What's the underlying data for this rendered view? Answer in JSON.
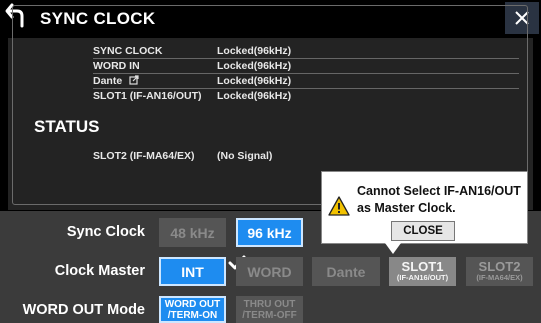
{
  "window": {
    "title": "SYNC CLOCK",
    "back_icon": "back-arrow-icon",
    "close_icon": "close-icon"
  },
  "status": {
    "label": "STATUS",
    "rows": [
      {
        "name": "SYNC CLOCK",
        "value": "Locked(96kHz)",
        "separator": true
      },
      {
        "name": "WORD IN",
        "value": "Locked(96kHz)",
        "separator": true
      },
      {
        "name": "Dante",
        "value": "Locked(96kHz)",
        "separator": true,
        "icon": "external-link-icon"
      },
      {
        "name": "SLOT1 (IF-AN16/OUT)",
        "value": "Locked(96kHz)",
        "separator": false
      },
      {
        "name": "SLOT2 (IF-MA64/EX)",
        "value": "(No Signal)",
        "separator": false
      }
    ]
  },
  "controls": {
    "sync_clock": {
      "label": "Sync Clock",
      "options": [
        "48 kHz",
        "96 kHz"
      ],
      "selected": "96 kHz"
    },
    "clock_master": {
      "label": "Clock Master",
      "int": "INT",
      "word": "WORD",
      "dante": "Dante",
      "slot1_line1": "SLOT1",
      "slot1_line2": "(IF-AN16/OUT)",
      "slot2_line1": "SLOT2",
      "slot2_line2": "(IF-MA64/EX)",
      "selected": "INT",
      "checked_icon": "checkmark-icon"
    },
    "word_out_mode": {
      "label": "WORD OUT Mode",
      "opt1_line1": "WORD OUT",
      "opt1_line2": "/TERM-ON",
      "opt2_line1": "THRU OUT",
      "opt2_line2": "/TERM-OFF",
      "selected": "WORD OUT /TERM-ON"
    }
  },
  "popup": {
    "message_line1": "Cannot Select IF-AN16/OUT",
    "message_line2": "as Master Clock.",
    "close_label": "CLOSE",
    "icon": "warning-icon"
  },
  "colors": {
    "accent": "#1e8cf0",
    "panel": "#232323",
    "controls_bg": "#3b3b3b",
    "disabled_btn": "#555555"
  }
}
